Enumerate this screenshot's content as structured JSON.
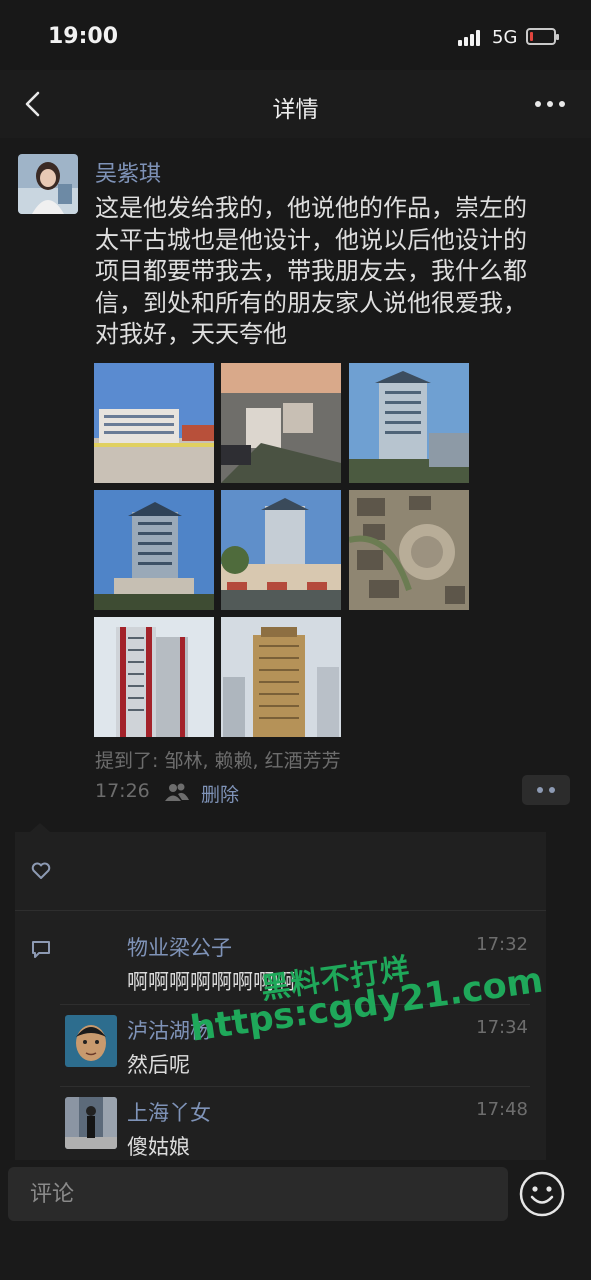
{
  "status_bar": {
    "time": "19:00",
    "network": "5G",
    "battery_color": "#e0453e"
  },
  "navbar": {
    "title": "详情",
    "back_icon": "chevron-left-icon",
    "more_icon": "ellipsis-icon"
  },
  "post": {
    "author": "吴紫琪",
    "text": "这是他发给我的，他说他的作品，崇左的\n太平古城也是他设计，他说以后他设计的\n项目都要带我去，带我朋友去，我什么都\n信，到处和所有的朋友家人说他很爱我，\n对我好，天天夸他",
    "photos": [
      "building-photo-1",
      "building-photo-2",
      "building-photo-3",
      "building-photo-4",
      "building-photo-5",
      "aerial-photo-6",
      "tower-photo-7",
      "tower-photo-8"
    ],
    "mentions": "提到了: 邹林, 赖赖, 红酒芳芳",
    "time": "17:26",
    "delete_label": "删除"
  },
  "comments": [
    {
      "name": "物业梁公子",
      "time": "17:32",
      "text": "啊啊啊啊啊啊啊啊"
    },
    {
      "name": "泸沽湖杨",
      "time": "17:34",
      "text": "然后呢"
    },
    {
      "name": "上海丫女",
      "time": "17:48",
      "text": "傻姑娘"
    }
  ],
  "watermark": {
    "line1": "黑料不打烊",
    "line2": "https:cgdy21.com"
  },
  "footer": {
    "comment_placeholder": "评论",
    "emoji_icon": "smiley-icon"
  },
  "colors": {
    "link": "#7f93b8",
    "background": "#191919",
    "watermark": "#1fa85a"
  }
}
